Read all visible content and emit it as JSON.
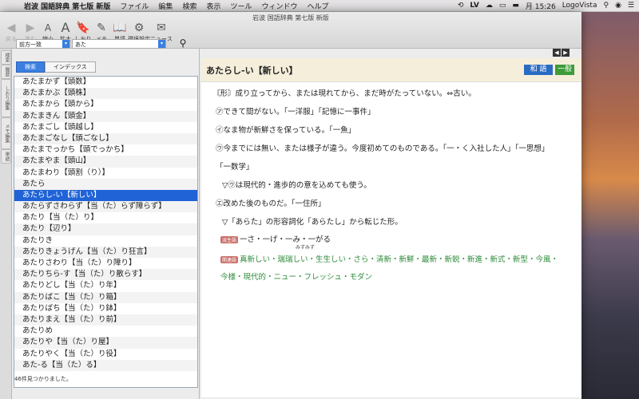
{
  "menubar": {
    "app": "岩波 国語辞典 第七版 新版",
    "items": [
      "ファイル",
      "編集",
      "検索",
      "表示",
      "ツール",
      "ウィンドウ",
      "ヘルプ"
    ],
    "lv": "LV",
    "clock": "月 15:26",
    "app_name_right": "LogoVista"
  },
  "window": {
    "title": "岩波 国語辞典 第七版 新版",
    "toolbar": [
      {
        "label": "戻る",
        "icon": "back-arrow-icon",
        "disabled": true
      },
      {
        "label": "進む",
        "icon": "forward-arrow-icon",
        "disabled": true
      },
      {
        "label": "縮小",
        "icon": "font-smaller-icon",
        "disabled": false
      },
      {
        "label": "拡大",
        "icon": "font-larger-icon",
        "disabled": false
      },
      {
        "label": "しおり",
        "icon": "bookmark-icon",
        "disabled": false
      },
      {
        "label": "メモ",
        "icon": "memo-icon",
        "disabled": false
      },
      {
        "label": "単語",
        "icon": "word-icon",
        "disabled": false
      },
      {
        "label": "環境設定",
        "icon": "gear-icon",
        "disabled": false
      },
      {
        "label": "ニュース",
        "icon": "news-icon",
        "disabled": false
      }
    ]
  },
  "rail": {
    "tabs": [
      "検索",
      "履歴",
      "しおり編集",
      "メモ編集",
      "単語"
    ]
  },
  "search": {
    "mode": "前方一致",
    "query": "あた",
    "tabs": [
      "検索",
      "インデックス"
    ]
  },
  "list": {
    "items": [
      "あたまかず【頭数】",
      "あたまかぶ【頭株】",
      "あたまから【頭から】",
      "あたまきん【頭金】",
      "あたまごし【頭越し】",
      "あたまごなし【頭ごなし】",
      "あたまでっかち【頭でっかち】",
      "あたまやま【頭山】",
      "あたまわり【頭割（り）】",
      "あたら",
      "あたらし-い【新しい】",
      "あたらずさわらず【当（た）らず障らず】",
      "あたり【当（た）り】",
      "あたり【辺り】",
      "あたりき",
      "あたりきょうげん【当（た）り狂言】",
      "あたりさわり【当（た）り障り】",
      "あたりちら-す【当（た）り散らす】",
      "あたりどし【当（た）り年】",
      "あたりばこ【当（た）り箱】",
      "あたりばち【当（た）り鉢】",
      "あたりまえ【当（た）り前】",
      "あたりめ",
      "あたりや【当（た）り屋】",
      "あたりやく【当（た）り役】",
      "あた-る【当（た）る】"
    ],
    "selected_index": 10,
    "status": "46件見つかりました。"
  },
  "entry": {
    "headword": "あたらし-い【新しい】",
    "tag_wago": "和 語",
    "tag_ippan": "一般",
    "lines": [
      "〘形〙成り立ってから、または現れてから、まだ時がたっていない。⇔古い。",
      "㋐できて間がない。「一洋服」「記憶に一事件」",
      "㋑なま物が新鮮さを保っている。「一魚」",
      "㋒今までには無い、または様子が違う。今度初めてのものである。「一・く入社した人」「一思想」",
      "「一数学」",
      "▽㋒は現代的・進歩的の意を込めても使う。",
      "㋓改めた後のものだ。「一住所」",
      "▽「あらた」の形容詞化「あらたし」から転じた形。"
    ],
    "derived_badge": "派生語",
    "derived": "一さ・一げ・一み・一がる",
    "related_badge": "関連語",
    "related_1": "真新しい・瑞瑞しい・生生しい・さら・清新・新鮮・最新・新鋭・新進・新式・新型・今風・",
    "related_2": "今様・現代的・ニュー・フレッシュ・モダン",
    "ruby": "みずみず"
  }
}
